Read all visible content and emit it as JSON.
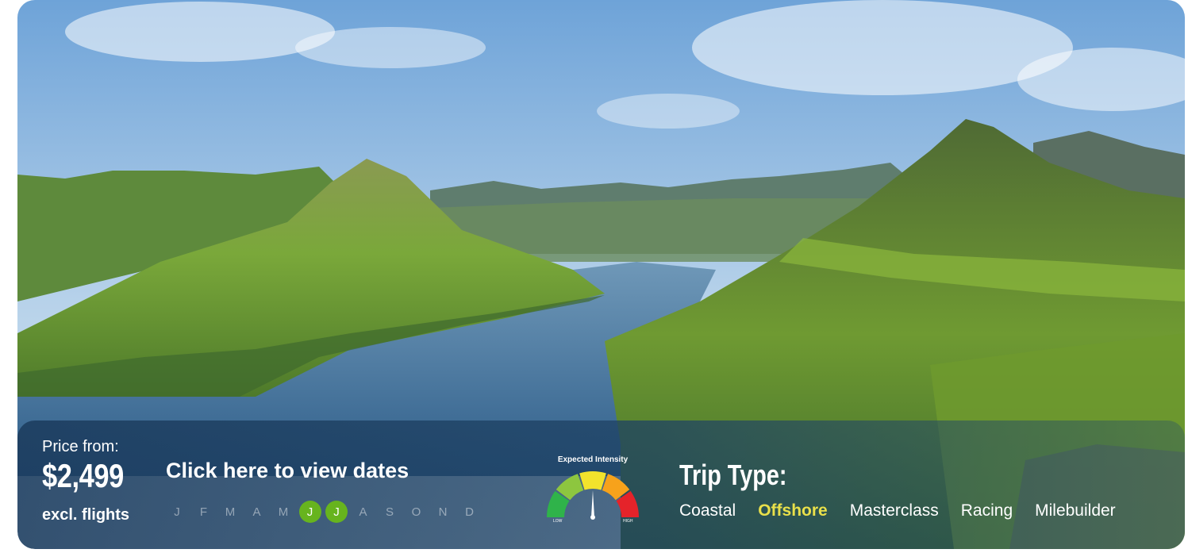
{
  "hero": {
    "image_alt": "Faroe Islands fjord with green mountains",
    "sky_top": "#6ea3d8",
    "water": "#3d6c96",
    "grass": "#7ea838"
  },
  "price": {
    "label": "Price from:",
    "value": "$2,499",
    "note": "excl. flights"
  },
  "dates": {
    "link_label": "Click here to view dates",
    "months": [
      {
        "letter": "J",
        "active": false
      },
      {
        "letter": "F",
        "active": false
      },
      {
        "letter": "M",
        "active": false
      },
      {
        "letter": "A",
        "active": false
      },
      {
        "letter": "M",
        "active": false
      },
      {
        "letter": "J",
        "active": true
      },
      {
        "letter": "J",
        "active": true
      },
      {
        "letter": "A",
        "active": false
      },
      {
        "letter": "S",
        "active": false
      },
      {
        "letter": "O",
        "active": false
      },
      {
        "letter": "N",
        "active": false
      },
      {
        "letter": "D",
        "active": false
      }
    ],
    "active_color": "#67b41e"
  },
  "intensity": {
    "title": "Expected Intensity",
    "low_label": "LOW",
    "high_label": "HIGH",
    "level": 0.5,
    "segment_colors": [
      "#2fb34a",
      "#8dc63f",
      "#f2e32c",
      "#f7a21b",
      "#e5232a"
    ]
  },
  "trip": {
    "title": "Trip Type:",
    "types": [
      {
        "label": "Coastal",
        "active": false
      },
      {
        "label": "Offshore",
        "active": true
      },
      {
        "label": "Masterclass",
        "active": false
      },
      {
        "label": "Racing",
        "active": false
      },
      {
        "label": "Milebuilder",
        "active": false
      }
    ],
    "active_color": "#e9e04a"
  }
}
